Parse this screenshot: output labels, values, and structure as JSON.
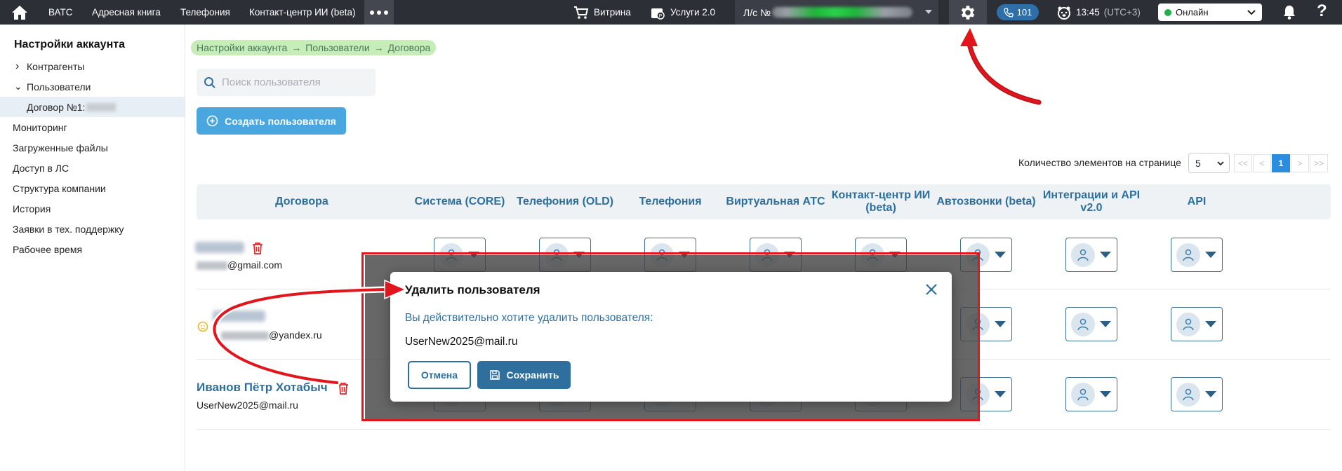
{
  "topbar": {
    "nav": [
      "ВАТС",
      "Адресная книга",
      "Телефония",
      "Контакт-центр ИИ (beta)"
    ],
    "showcase": "Витрина",
    "services": "Услуги 2.0",
    "ls_label": "Л/с №",
    "calls_count": "101",
    "time": "13:45",
    "timezone": "(UTC+3)",
    "status": "Онлайн",
    "help": "?"
  },
  "sidebar": {
    "title": "Настройки аккаунта",
    "items": [
      {
        "label": "Контрагенты",
        "expander": "›"
      },
      {
        "label": "Пользователи",
        "expander": "⌄"
      },
      {
        "label": "Договор №1:"
      },
      {
        "label": "Мониторинг"
      },
      {
        "label": "Загруженные файлы"
      },
      {
        "label": "Доступ в ЛС"
      },
      {
        "label": "Структура компании"
      },
      {
        "label": "История"
      },
      {
        "label": "Заявки в тех. поддержку"
      },
      {
        "label": "Рабочее время"
      }
    ]
  },
  "breadcrumb": {
    "items": [
      "Настройки аккаунта",
      "Пользователи",
      "Договора"
    ],
    "sep": "→"
  },
  "search": {
    "placeholder": "Поиск пользователя"
  },
  "create_button": "Создать пользователя",
  "pagination": {
    "label": "Количество элементов на странице",
    "per_page": "5",
    "first": "<<",
    "prev": "<",
    "current": "1",
    "next": ">",
    "last": ">>"
  },
  "table": {
    "columns": [
      "Договора",
      "Система (CORE)",
      "Телефония (OLD)",
      "Телефония",
      "Виртуальная АТС",
      "Контакт-центр ИИ (beta)",
      "Автозвонки (beta)",
      "Интеграции и API v2.0",
      "API"
    ],
    "rows": [
      {
        "email_suffix": "@gmail.com"
      },
      {
        "email_suffix": "@yandex.ru"
      },
      {
        "name": "Иванов Пётр Хотабыч",
        "email": "UserNew2025@mail.ru"
      }
    ]
  },
  "dialog": {
    "title": "Удалить пользователя",
    "question": "Вы действительно хотите удалить пользователя:",
    "email": "UserNew2025@mail.ru",
    "cancel": "Отмена",
    "save": "Сохранить"
  },
  "colors": {
    "accent": "#2f6f9e",
    "create_button": "#4aa6de",
    "annotation": "#e2141c",
    "online": "#21b14b"
  }
}
